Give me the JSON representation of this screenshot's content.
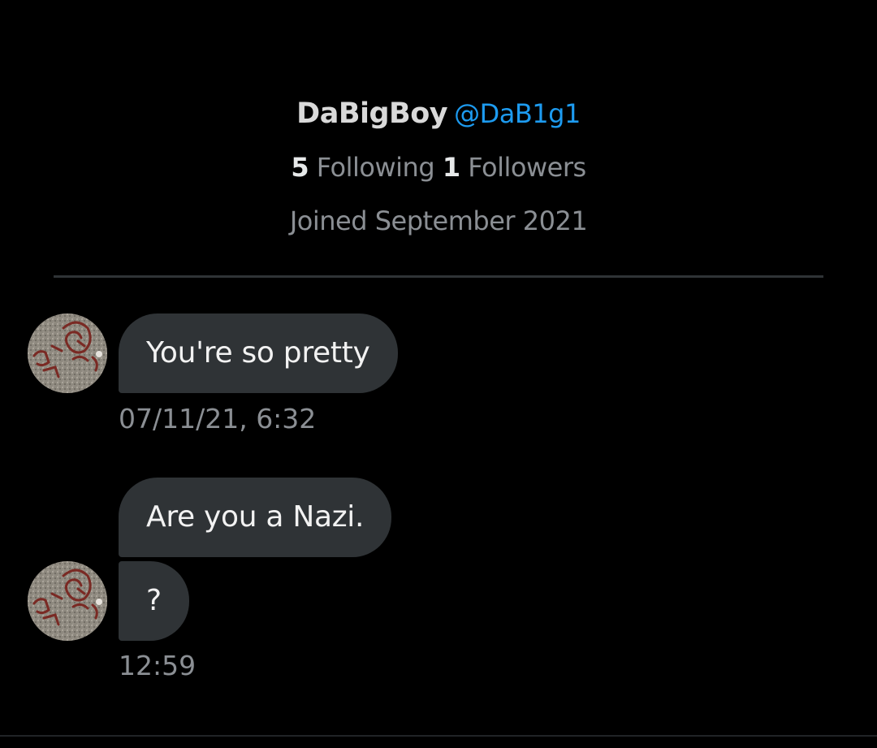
{
  "profile": {
    "display_name": "DaBigBoy",
    "handle": "@DaB1g1",
    "following_count": "5",
    "following_label": "Following",
    "followers_count": "1",
    "followers_label": "Followers",
    "joined": "Joined September 2021"
  },
  "messages": [
    {
      "text": "You're so pretty",
      "timestamp": "07/11/21, 6:32"
    },
    {
      "text": "Are you a Nazi."
    },
    {
      "text": "?",
      "timestamp": "12:59"
    }
  ],
  "colors": {
    "background": "#000000",
    "bubble": "#2f3336",
    "accent": "#1d9bf0",
    "secondary_text": "#8b8f94"
  }
}
